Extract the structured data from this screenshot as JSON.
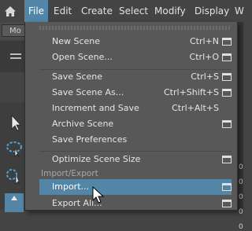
{
  "menubar": {
    "items": [
      {
        "label": "File",
        "active": true
      },
      {
        "label": "Edit"
      },
      {
        "label": "Create"
      },
      {
        "label": "Select"
      },
      {
        "label": "Modify"
      },
      {
        "label": "Display"
      },
      {
        "label": "W"
      }
    ]
  },
  "background": {
    "mode_dropdown_text": "Mo"
  },
  "file_menu": {
    "items": [
      {
        "label": "New Scene",
        "shortcut": "Ctrl+N",
        "has_options": true
      },
      {
        "label": "Open Scene...",
        "shortcut": "Ctrl+O",
        "has_options": true
      },
      {
        "label": "Save Scene",
        "shortcut": "Ctrl+S",
        "has_options": true
      },
      {
        "label": "Save Scene As...",
        "shortcut": "Ctrl+Shift+S",
        "has_options": true
      },
      {
        "label": "Increment and Save",
        "shortcut": "Ctrl+Alt+S",
        "has_options": false
      },
      {
        "label": "Archive Scene",
        "shortcut": "",
        "has_options": true
      },
      {
        "label": "Save Preferences",
        "shortcut": "",
        "has_options": false
      },
      {
        "label": "Optimize Scene Size",
        "shortcut": "",
        "has_options": true
      },
      {
        "label": "Import...",
        "shortcut": "",
        "has_options": true,
        "highlighted": true
      },
      {
        "label": "Export All...",
        "shortcut": "",
        "has_options": true
      }
    ],
    "section_import_export": "Import/Export"
  },
  "colors": {
    "highlight": "#5285a6",
    "menu_bg": "#585858",
    "app_bg": "#444444"
  }
}
